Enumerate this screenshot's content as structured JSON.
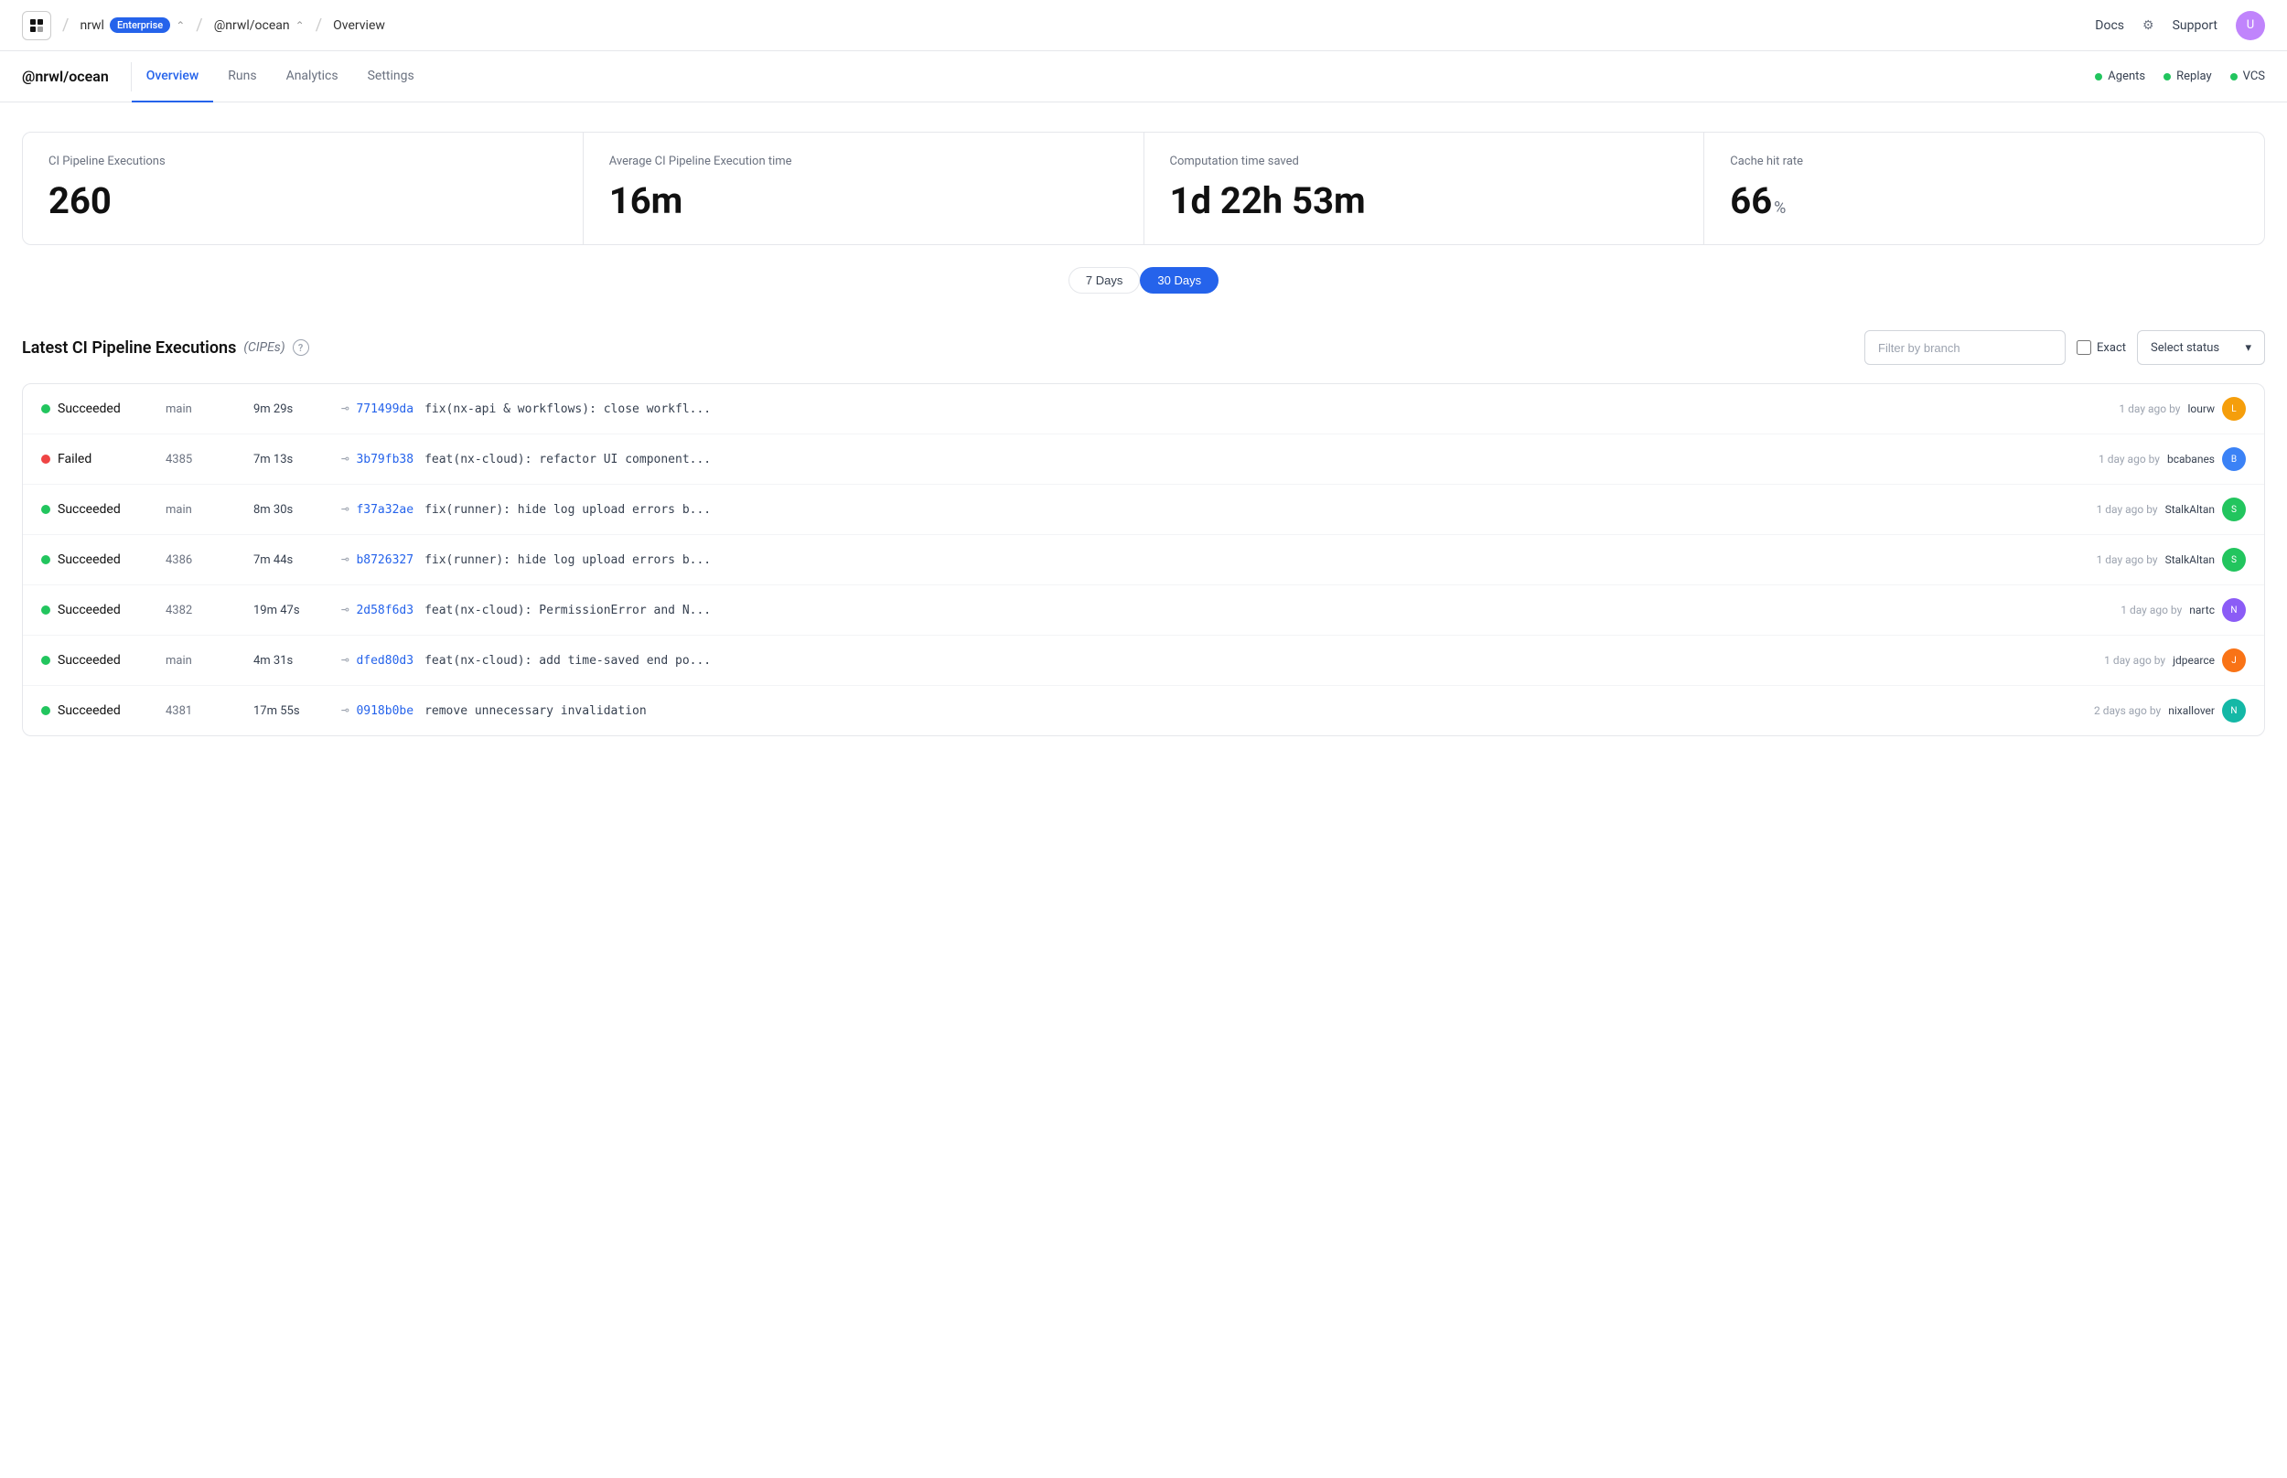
{
  "topNav": {
    "logoAlt": "NX Logo",
    "breadcrumb": [
      {
        "label": "nrwl",
        "badge": "Enterprise"
      },
      {
        "label": "@nrwl/ocean"
      },
      {
        "label": "Overview"
      }
    ],
    "links": [
      {
        "label": "Docs"
      },
      {
        "label": "Support"
      }
    ]
  },
  "orgNav": {
    "orgName": "@nrwl/ocean",
    "tabs": [
      {
        "label": "Overview",
        "active": true
      },
      {
        "label": "Runs",
        "active": false
      },
      {
        "label": "Analytics",
        "active": false
      },
      {
        "label": "Settings",
        "active": false
      }
    ],
    "statusItems": [
      {
        "label": "Agents"
      },
      {
        "label": "Replay"
      },
      {
        "label": "VCS"
      }
    ]
  },
  "stats": {
    "period": {
      "options": [
        "7 Days",
        "30 Days"
      ],
      "active": "30 Days"
    },
    "cards": [
      {
        "label": "CI Pipeline Executions",
        "value": "260",
        "unit": ""
      },
      {
        "label": "Average CI Pipeline Execution time",
        "value": "16m",
        "unit": ""
      },
      {
        "label": "Computation time saved",
        "value": "1d 22h 53m",
        "unit": ""
      },
      {
        "label": "Cache hit rate",
        "value": "66",
        "unit": "%"
      }
    ]
  },
  "pipeline": {
    "title": "Latest CI Pipeline Executions",
    "cipesLabel": "(CIPEs)",
    "filterPlaceholder": "Filter by branch",
    "exactLabel": "Exact",
    "statusSelectLabel": "Select status",
    "rows": [
      {
        "status": "Succeeded",
        "statusType": "success",
        "branch": "main",
        "duration": "9m 29s",
        "commitHash": "771499da",
        "commitMsg": "fix(nx-api & workflows): close workfl...",
        "timeAgo": "1 day ago",
        "author": "lourw",
        "avatarColor": "av-yellow"
      },
      {
        "status": "Failed",
        "statusType": "failed",
        "branch": "4385",
        "duration": "7m 13s",
        "commitHash": "3b79fb38",
        "commitMsg": "feat(nx-cloud): refactor UI component...",
        "timeAgo": "1 day ago",
        "author": "bcabanes",
        "avatarColor": "av-blue"
      },
      {
        "status": "Succeeded",
        "statusType": "success",
        "branch": "main",
        "duration": "8m 30s",
        "commitHash": "f37a32ae",
        "commitMsg": "fix(runner): hide log upload errors b...",
        "timeAgo": "1 day ago",
        "author": "StalkAltan",
        "avatarColor": "av-green"
      },
      {
        "status": "Succeeded",
        "statusType": "success",
        "branch": "4386",
        "duration": "7m 44s",
        "commitHash": "b8726327",
        "commitMsg": "fix(runner): hide log upload errors b...",
        "timeAgo": "1 day ago",
        "author": "StalkAltan",
        "avatarColor": "av-green"
      },
      {
        "status": "Succeeded",
        "statusType": "success",
        "branch": "4382",
        "duration": "19m 47s",
        "commitHash": "2d58f6d3",
        "commitMsg": "feat(nx-cloud): PermissionError and N...",
        "timeAgo": "1 day ago",
        "author": "nartc",
        "avatarColor": "av-purple"
      },
      {
        "status": "Succeeded",
        "statusType": "success",
        "branch": "main",
        "duration": "4m 31s",
        "commitHash": "dfed80d3",
        "commitMsg": "feat(nx-cloud): add time-saved end po...",
        "timeAgo": "1 day ago",
        "author": "jdpearce",
        "avatarColor": "av-orange"
      },
      {
        "status": "Succeeded",
        "statusType": "success",
        "branch": "4381",
        "duration": "17m 55s",
        "commitHash": "0918b0be",
        "commitMsg": "remove unnecessary invalidation",
        "timeAgo": "2 days ago",
        "author": "nixallover",
        "avatarColor": "av-teal"
      }
    ]
  }
}
